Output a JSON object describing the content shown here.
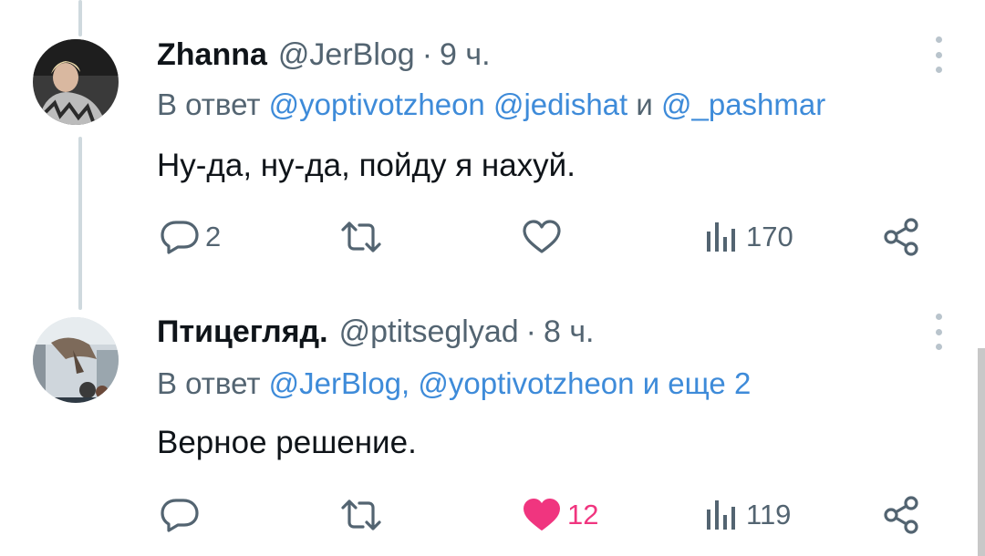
{
  "tweets": [
    {
      "author_name": "Zhanna",
      "handle": "@JerBlog",
      "separator": "·",
      "time": "9 ч.",
      "reply_prefix": "В ответ",
      "reply_mentions": [
        "@yoptivotzheon",
        "@jedishat"
      ],
      "reply_and": "и",
      "reply_more": "@_pashmar",
      "text": "Ну-да, ну-да, пойду я нахуй.",
      "replies": "2",
      "likes": "",
      "views": "170",
      "liked": false
    },
    {
      "author_name": "Птицегляд.",
      "handle": "@ptitseglyad",
      "separator": "·",
      "time": "8 ч.",
      "reply_prefix": "В ответ",
      "reply_mentions": [
        "@JerBlog,",
        "@yoptivotzheon"
      ],
      "reply_and": "и",
      "reply_more": "еще 2",
      "text": "Верное решение.",
      "replies": "",
      "likes": "12",
      "views": "119",
      "liked": true
    }
  ],
  "colors": {
    "link": "#3e8bd9",
    "muted": "#536471",
    "like_active": "#f0357f"
  },
  "icons": [
    "reply-icon",
    "retweet-icon",
    "like-icon",
    "views-icon",
    "share-icon",
    "more-icon"
  ]
}
